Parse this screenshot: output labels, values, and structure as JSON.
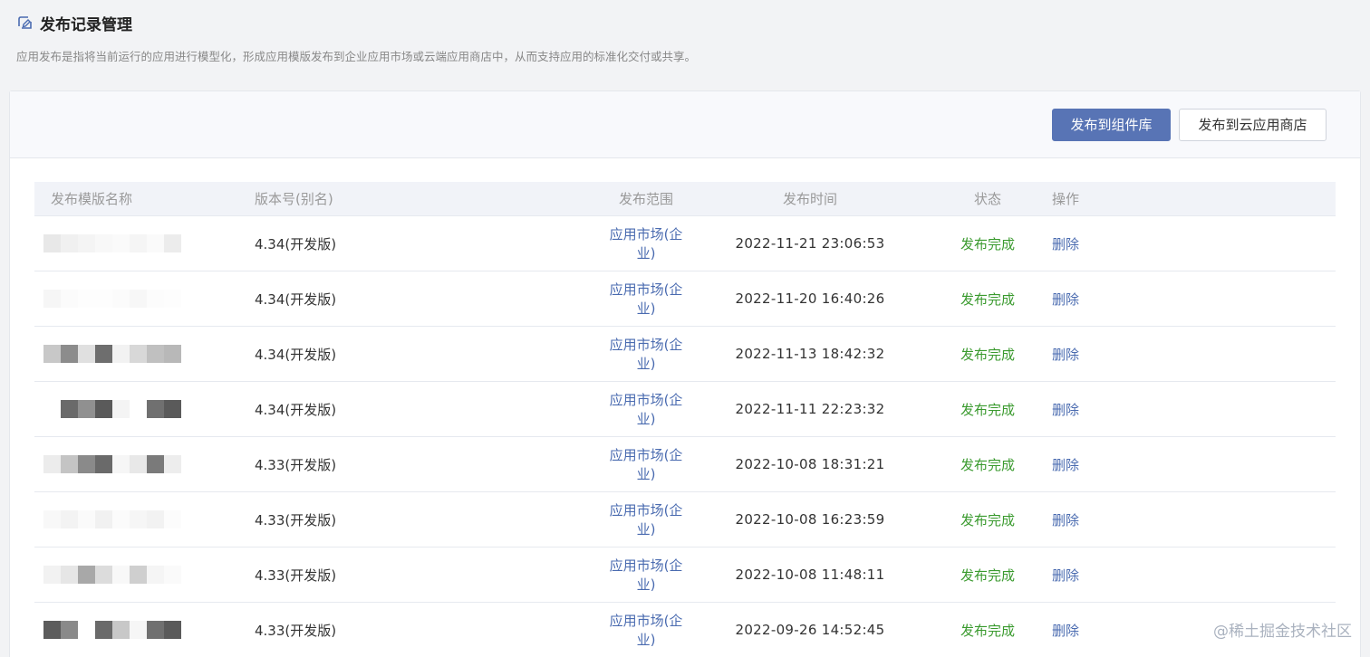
{
  "header": {
    "title": "发布记录管理",
    "description": "应用发布是指将当前运行的应用进行模型化，形成应用模版发布到企业应用市场或云端应用商店中，从而支持应用的标准化交付或共享。"
  },
  "toolbar": {
    "publish_component_label": "发布到组件库",
    "publish_cloud_label": "发布到云应用商店"
  },
  "table": {
    "columns": [
      "发布模版名称",
      "版本号(别名)",
      "发布范围",
      "发布时间",
      "状态",
      "操作"
    ],
    "rows": [
      {
        "version": "4.34(开发版)",
        "scope": "应用市场(企业)",
        "time": "2022-11-21 23:06:53",
        "status": "发布完成",
        "action": "删除"
      },
      {
        "version": "4.34(开发版)",
        "scope": "应用市场(企业)",
        "time": "2022-11-20 16:40:26",
        "status": "发布完成",
        "action": "删除"
      },
      {
        "version": "4.34(开发版)",
        "scope": "应用市场(企业)",
        "time": "2022-11-13 18:42:32",
        "status": "发布完成",
        "action": "删除"
      },
      {
        "version": "4.34(开发版)",
        "scope": "应用市场(企业)",
        "time": "2022-11-11 22:23:32",
        "status": "发布完成",
        "action": "删除"
      },
      {
        "version": "4.33(开发版)",
        "scope": "应用市场(企业)",
        "time": "2022-10-08 18:31:21",
        "status": "发布完成",
        "action": "删除"
      },
      {
        "version": "4.33(开发版)",
        "scope": "应用市场(企业)",
        "time": "2022-10-08 16:23:59",
        "status": "发布完成",
        "action": "删除"
      },
      {
        "version": "4.33(开发版)",
        "scope": "应用市场(企业)",
        "time": "2022-10-08 11:48:11",
        "status": "发布完成",
        "action": "删除"
      },
      {
        "version": "4.33(开发版)",
        "scope": "应用市场(企业)",
        "time": "2022-09-26 14:52:45",
        "status": "发布完成",
        "action": "删除"
      }
    ]
  },
  "watermark": "@稀土掘金技术社区",
  "colors": {
    "primary": "#5874b5",
    "link": "#4a6bb0",
    "success": "#3a9a2e"
  }
}
